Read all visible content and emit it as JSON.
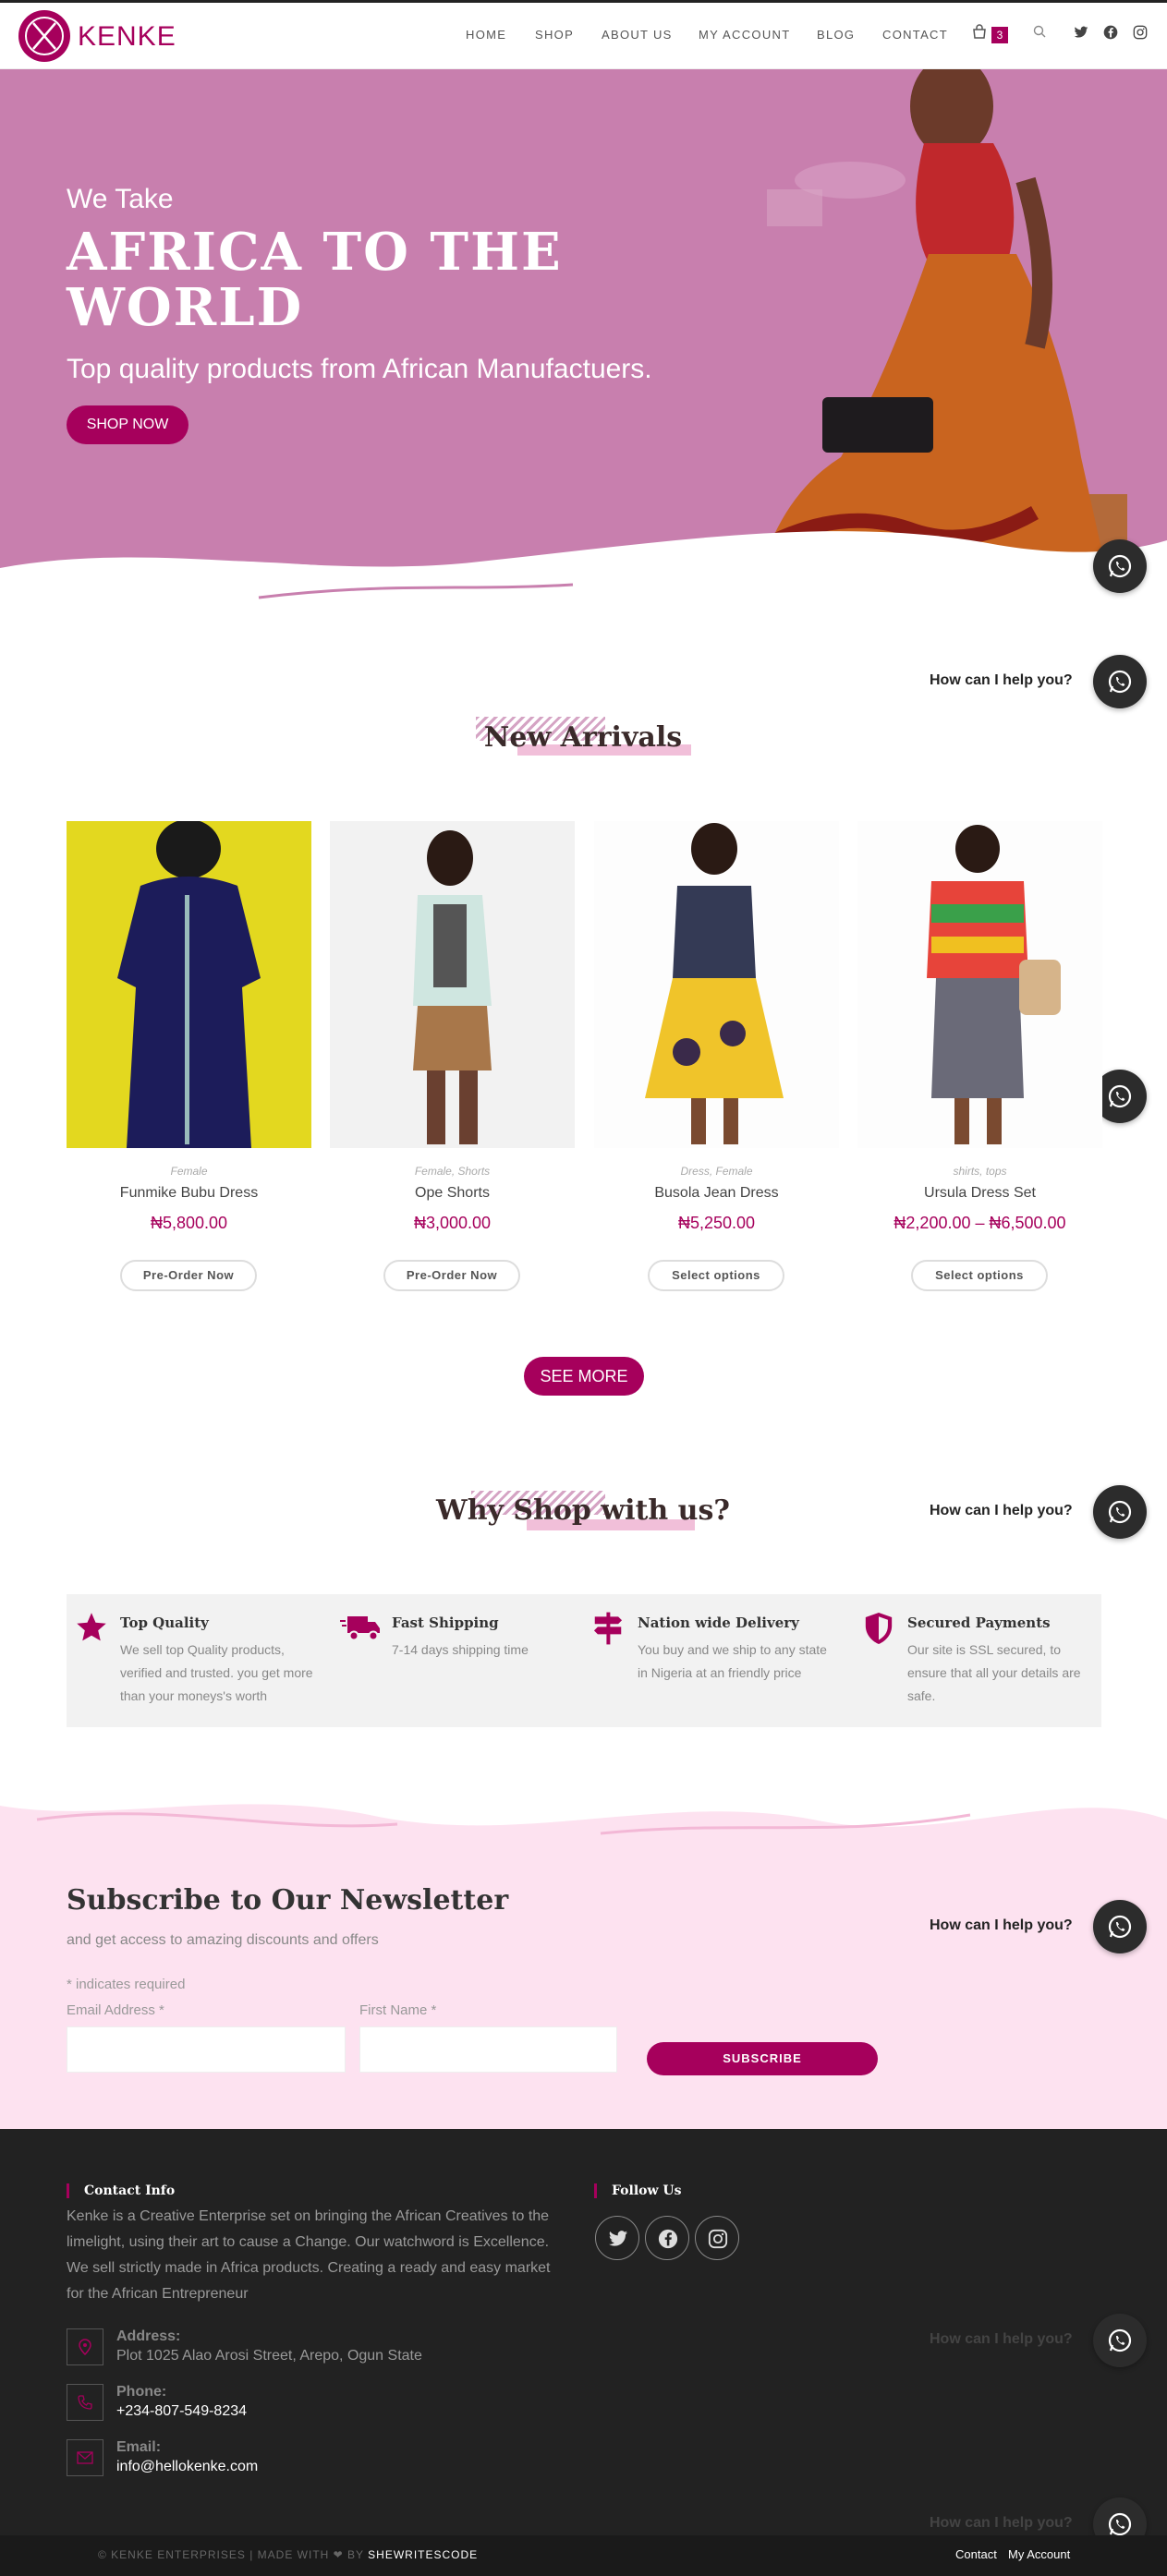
{
  "brand": {
    "name": "KENKE",
    "color": "#a6005c"
  },
  "nav": {
    "items": [
      "HOME",
      "SHOP",
      "ABOUT US",
      "MY ACCOUNT",
      "BLOG",
      "CONTACT"
    ],
    "cart_count": "3",
    "icons": [
      "cart-icon",
      "search-icon",
      "twitter-icon",
      "facebook-icon",
      "instagram-icon"
    ]
  },
  "hero": {
    "lead": "We Take",
    "title": "AFRICA TO THE WORLD",
    "subtitle": "Top quality products from African Manufactuers.",
    "button": "SHOP NOW"
  },
  "whatsapp": {
    "label": "How can I help you?",
    "icon": "whatsapp-icon"
  },
  "arrivals": {
    "title": "New Arrivals",
    "products": [
      {
        "category": "Female",
        "name": "Funmike Bubu Dress",
        "price": "₦5,800.00",
        "button": "Pre-Order Now"
      },
      {
        "category": "Female, Shorts",
        "name": "Ope Shorts",
        "price": "₦3,000.00",
        "button": "Pre-Order Now"
      },
      {
        "category": "Dress, Female",
        "name": "Busola Jean Dress",
        "price": "₦5,250.00",
        "button": "Select options"
      },
      {
        "category": "shirts, tops",
        "name": "Ursula Dress Set",
        "price": "₦2,200.00 – ₦6,500.00",
        "button": "Select options"
      }
    ],
    "see_more": "SEE MORE"
  },
  "why": {
    "title": "Why Shop with us?",
    "features": [
      {
        "icon": "star-icon",
        "title": "Top Quality",
        "text_lines": [
          "We sell top Quality products,",
          "verified and trusted. you get more",
          "than your moneys's worth"
        ]
      },
      {
        "icon": "truck-icon",
        "title": "Fast Shipping",
        "text_lines": [
          "7-14 days shipping time"
        ]
      },
      {
        "icon": "signpost-icon",
        "title": "Nation wide Delivery",
        "text_lines": [
          "You buy and we ship to any state",
          "in Nigeria at an friendly price"
        ]
      },
      {
        "icon": "shield-icon",
        "title": "Secured Payments",
        "text_lines": [
          "Our site is SSL secured, to",
          "ensure that all your details are",
          "safe."
        ]
      }
    ]
  },
  "newsletter": {
    "title": "Subscribe to Our Newsletter",
    "subtitle": "and get access to amazing discounts and offers",
    "required_note": "* indicates required",
    "email_label": "Email Address *",
    "firstname_label": "First Name *",
    "button": "SUBSCRIBE"
  },
  "footer": {
    "contact_title": "Contact Info",
    "follow_title": "Follow Us",
    "about_lines": [
      "Kenke is a Creative Enterprise set on bringing the African Creatives to the",
      "limelight, using their art to cause a Change. Our watchword is Excellence.",
      "We sell strictly made in Africa products. Creating a ready and easy market",
      "for the African Entrepreneur"
    ],
    "address_label": "Address:",
    "address": "Plot 1025 Alao Arosi Street, Arepo, Ogun State",
    "phone_label": "Phone:",
    "phone": "+234-807-549-8234",
    "email_label": "Email:",
    "email": "info@hellokenke.com",
    "copyright_pre": "© KENKE ENTERPRISES | MADE WITH ❤ BY ",
    "copyright_author": "SHEWRITESCODE",
    "links": [
      "Contact",
      "My Account"
    ]
  }
}
